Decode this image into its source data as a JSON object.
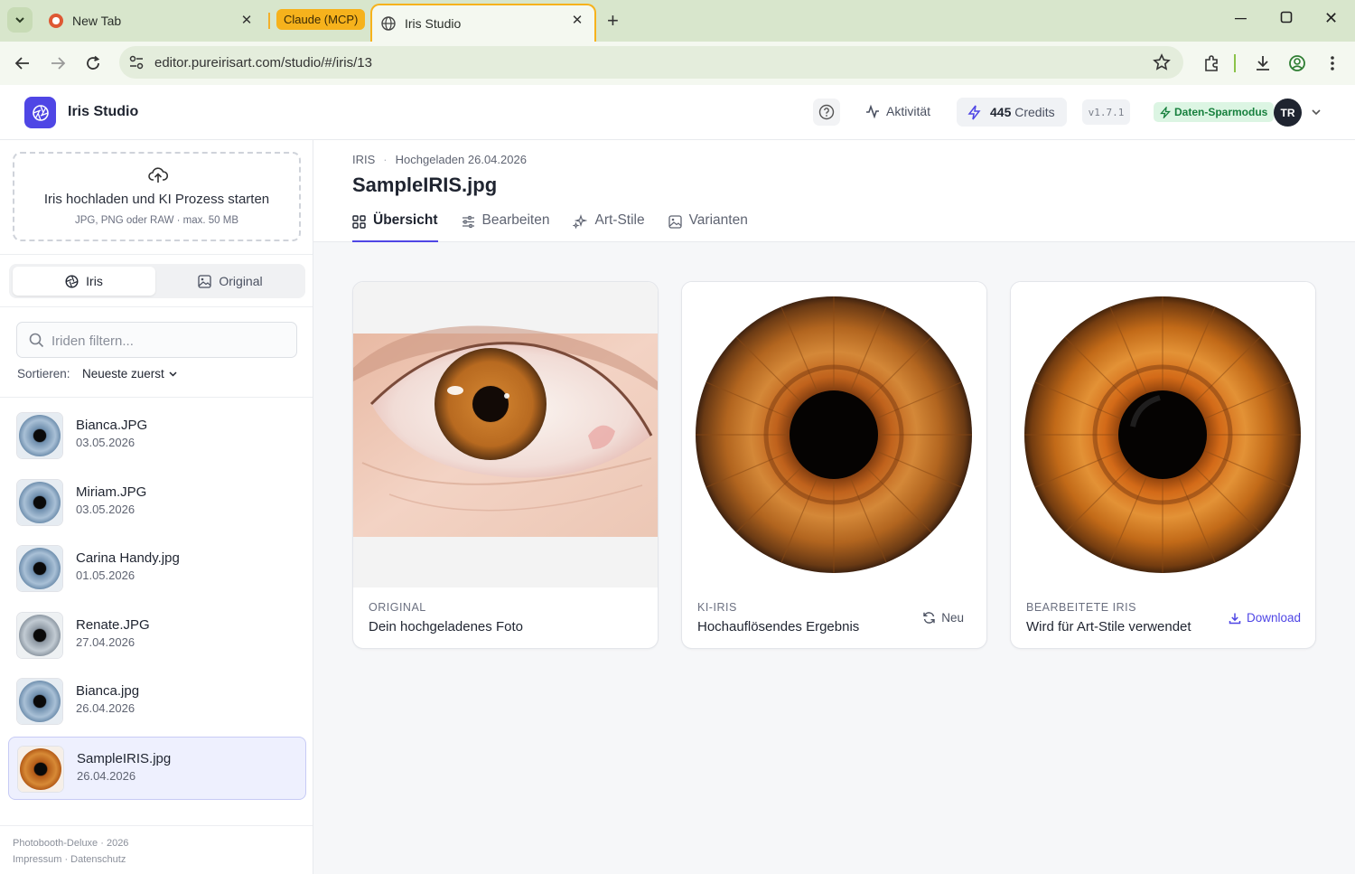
{
  "browser": {
    "tabs": [
      {
        "title": "New Tab"
      },
      {
        "group_label": "Claude (MCP)"
      },
      {
        "title": "Iris Studio"
      }
    ],
    "url": "editor.pureirisart.com/studio/#/iris/13"
  },
  "app": {
    "title": "Iris Studio",
    "activity_label": "Aktivität",
    "credits_count": "445",
    "credits_label": "Credits",
    "version": "v1.7.1",
    "data_saving_label": "Daten-Sparmodus",
    "avatar_initials": "TR"
  },
  "sidebar": {
    "upload": {
      "title": "Iris hochladen und KI Prozess starten",
      "subtitle": "JPG, PNG oder RAW · max. 50 MB"
    },
    "segments": [
      {
        "label": "Iris",
        "active": true
      },
      {
        "label": "Original",
        "active": false
      }
    ],
    "filter_placeholder": "Iriden filtern...",
    "sort_label": "Sortieren:",
    "sort_value": "Neueste zuerst",
    "items": [
      {
        "name": "Bianca.JPG",
        "date": "03.05.2026",
        "eye": "blue"
      },
      {
        "name": "Miriam.JPG",
        "date": "03.05.2026",
        "eye": "blue"
      },
      {
        "name": "Carina Handy.jpg",
        "date": "01.05.2026",
        "eye": "blue"
      },
      {
        "name": "Renate.JPG",
        "date": "27.04.2026",
        "eye": "grey"
      },
      {
        "name": "Bianca.jpg",
        "date": "26.04.2026",
        "eye": "blue"
      },
      {
        "name": "SampleIRIS.jpg",
        "date": "26.04.2026",
        "eye": "brown",
        "selected": true
      }
    ],
    "footer_line1": "Photobooth-Deluxe · 2026",
    "footer_line2": "Impressum · Datenschutz"
  },
  "main": {
    "breadcrumb_type": "IRIS",
    "breadcrumb_uploaded": "Hochgeladen 26.04.2026",
    "title": "SampleIRIS.jpg",
    "tabs": [
      {
        "label": "Übersicht",
        "icon": "grid-icon",
        "active": true
      },
      {
        "label": "Bearbeiten",
        "icon": "sliders-icon"
      },
      {
        "label": "Art-Stile",
        "icon": "sparkles-icon"
      },
      {
        "label": "Varianten",
        "icon": "image-icon"
      }
    ],
    "cards": [
      {
        "label": "ORIGINAL",
        "desc": "Dein hochgeladenes Foto"
      },
      {
        "label": "KI-IRIS",
        "desc": "Hochauflösendes Ergebnis",
        "action": "Neu"
      },
      {
        "label": "BEARBEITETE IRIS",
        "desc": "Wird für Art-Stile verwendet",
        "action": "Download"
      }
    ]
  },
  "colors": {
    "accent": "#4f46e5",
    "tab_group": "#f6b21c",
    "saving_badge": "#dcf5e3"
  }
}
